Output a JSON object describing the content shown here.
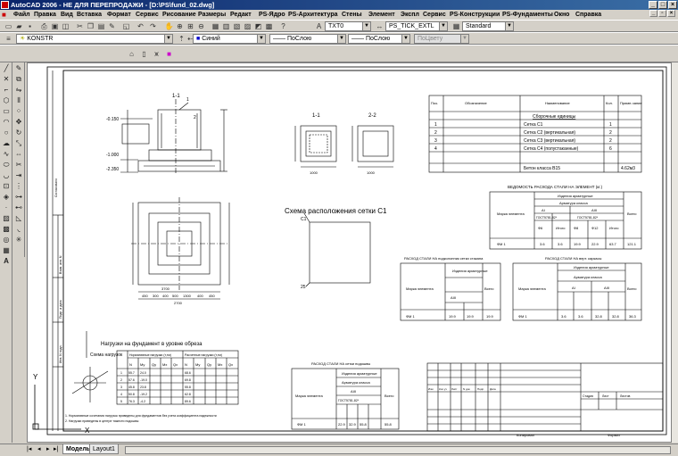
{
  "window": {
    "title": "AutoCAD 2006 - НЕ ДЛЯ ПЕРЕПРОДАЖИ - [D:\\PS\\fund_02.dwg]",
    "minimize": "_",
    "maximize": "□",
    "close": "×"
  },
  "menu": [
    "Файл",
    "Правка",
    "Вид",
    "Вставка",
    "Формат",
    "Сервис",
    "Рисование",
    "Размеры",
    "Редакт",
    "PS-Ядро",
    "PS-Архитектура",
    "Стены",
    "Элемент",
    "Экспл",
    "Сервис",
    "PS-Конструкции",
    "PS-Фундаменты",
    "Окно",
    "Справка"
  ],
  "toolbar": {
    "text_style": "TXT0",
    "dim_style": "PS_TICK_EXTL",
    "table_style": "Standard",
    "layer": "KONSTR",
    "color": "Синий",
    "linetype": "ПоСлою",
    "lineweight": "ПоСлою",
    "plotstyle": "ПоЦвету"
  },
  "tabs": [
    "Модель",
    "Layout1"
  ],
  "drawing": {
    "view_label": "1-1",
    "section_1": "1-1",
    "section_2": "2-2",
    "mesh_title": "Схема расположения сетки С1",
    "mesh_pos": "С1",
    "mesh_pos2": "25",
    "loads_title": "Нагрузки на фундамент в уровне обреза",
    "loads_scheme": "Схема нагрузок",
    "foot_note1": "1. Нормативные сочетания нагрузок приведены для фундаментов без учета коэффициента надежности",
    "foot_note2": "2. Нагрузки приведены в центре тяжести подошвы",
    "dims_plan": [
      "450",
      "300",
      "400",
      "500",
      "1300",
      "400",
      "450"
    ],
    "dims_plan_total": "2700",
    "dims_plan_sub": "3700",
    "dims_plan_right": [
      "450",
      "400",
      "600",
      "1300",
      "400",
      "450"
    ],
    "dim_heights": [
      "-0.150",
      "-1.000",
      "-2.350"
    ],
    "marker_1": "1",
    "marker_2": "2",
    "section_dims": [
      "1000",
      "1000"
    ],
    "spec_headers": [
      "Поз.",
      "Обозначение",
      "Наименование",
      "Кол.",
      "Приме-чание"
    ],
    "spec_group": "Сборочные единицы",
    "spec_rows": [
      {
        "pos": "1",
        "name": "Сетка С1",
        "qty": "1"
      },
      {
        "pos": "2",
        "name": "Сетка С2 (вертикальная)",
        "qty": "2"
      },
      {
        "pos": "3",
        "name": "Сетка С3 (вертикальная)",
        "qty": "2"
      },
      {
        "pos": "4",
        "name": "Сетка С4 (полустаканные)",
        "qty": "6"
      }
    ],
    "spec_concrete": "Бетон класса В15",
    "spec_concrete_vol": "4.62м3",
    "steel_title": "ВЕДОМОСТЬ РАСХОДА СТАЛИ НА ЭЛЕМЕНТ (кг.)",
    "steel_hdr_products": "Изделия арматурные",
    "steel_hdr_class": "Арматура класса",
    "steel_hdr_ai": "AI",
    "steel_hdr_aiii": "AIII",
    "steel_hdr_gost1": "ГОСТ5781-82*",
    "steel_hdr_gost2": "ГОСТ5781-82*",
    "steel_hdr_total": "Всего",
    "steel_elem": "Марка элемента",
    "steel_cols": [
      "Ф6",
      "Итого",
      "Ф8",
      "Ф12",
      "Итого"
    ],
    "steel_row": [
      "ФМ 1",
      "3.6",
      "3.6",
      "19.9",
      "22.9",
      "63.7",
      "105.5",
      "121.1"
    ],
    "steel2_title": "РАСХОД СТАЛИ НА подколонник сетки стакана",
    "steel2_row": [
      "ФМ 1",
      "19.9",
      "19.9",
      "19.9"
    ],
    "steel3_title": "РАСХОД СТАЛИ НА верт. каркасы",
    "steel3_row": [
      "ФМ 1",
      "3.6",
      "3.6",
      "32.8",
      "32.8",
      "36.3"
    ],
    "steel4_title": "РАСХОД СТАЛИ НА сетки подошвы",
    "steel4_row": [
      "ФМ 1",
      "22.9",
      "32.9",
      "55.8",
      "55.8"
    ],
    "loads_hdr_n": "Нормативные нагрузки (т,тм)",
    "loads_hdr_r": "Расчетные нагрузки (т,тм)",
    "loads_cols": [
      "N",
      "My",
      "Qy",
      "Mx",
      "Qx",
      "N",
      "My",
      "Qy",
      "Mx",
      "Qx"
    ],
    "loads_rows": [
      [
        "1",
        "55.7",
        "24.0",
        "3.4",
        "4.6",
        "3.3",
        "68.6",
        "24.0",
        "3.4",
        "4.6",
        "3.3"
      ],
      [
        "2",
        "57.6",
        "-19.0",
        "-2.6",
        "3.4",
        "2.5",
        "69.8",
        "-19.0",
        "-2.6",
        "3.4",
        "2.5"
      ],
      [
        "3",
        "45.8",
        "23.8",
        "3.4",
        "4.5",
        "3.3",
        "55.8",
        "23.8",
        "3.4",
        "4.5",
        "3.3"
      ],
      [
        "4",
        "50.8",
        "-19.2",
        "-2.5",
        "3.5",
        "2.5",
        "62.8",
        "-19.2",
        "-2.5",
        "3.5",
        "2.5"
      ],
      [
        "5",
        "76.3",
        "-4.2",
        "-0.5",
        "0.6",
        "0.5",
        "89.6",
        "-4.2",
        "-0.5",
        "0.6",
        "0.5"
      ]
    ],
    "stamp_cols": [
      "Изм",
      "Кол.уч",
      "Лист",
      "N док",
      "Подп.",
      "Дата"
    ],
    "stamp_right": [
      "Стадия",
      "Лист",
      "Листов"
    ],
    "stamp_bottom": "Копировал",
    "stamp_format": "Формат",
    "side_labels": [
      "Согласовано",
      "Взам. инв. N",
      "Подп. и дата",
      "Инв. N подл."
    ],
    "axis_y": "Y",
    "axis_x": "X"
  }
}
